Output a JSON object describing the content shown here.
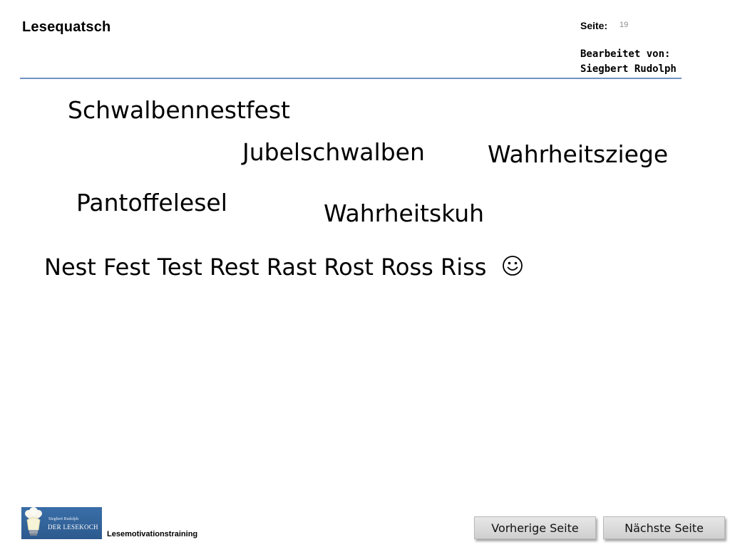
{
  "header": {
    "title": "Lesequatsch",
    "page_label": "Seite:",
    "page_number": "19",
    "edited_by_label": "Bearbeitet von:",
    "edited_by_name": "Siegbert Rudolph"
  },
  "words": {
    "w1": "Schwalbennestfest",
    "w2": "Jubelschwalben",
    "w3": "Wahrheitsziege",
    "w4": "Pantoffelesel",
    "w5": "Wahrheitskuh",
    "sentence": "Nest Fest Test Rest Rast Rost Ross Riss"
  },
  "icons": {
    "smiley": "smiley-icon",
    "logo": "lesekoch-logo"
  },
  "footer": {
    "logo_small_text": "Siegbert Rudolph",
    "logo_main_text": "DER LESEKOCH",
    "label": "Lesemotivationstraining",
    "prev_button": "Vorherige Seite",
    "next_button": "Nächste Seite"
  },
  "colors": {
    "header_rule": "#6f93c4",
    "logo_bg": "#3a6ea8",
    "button_bg": "#dcdcdc"
  }
}
